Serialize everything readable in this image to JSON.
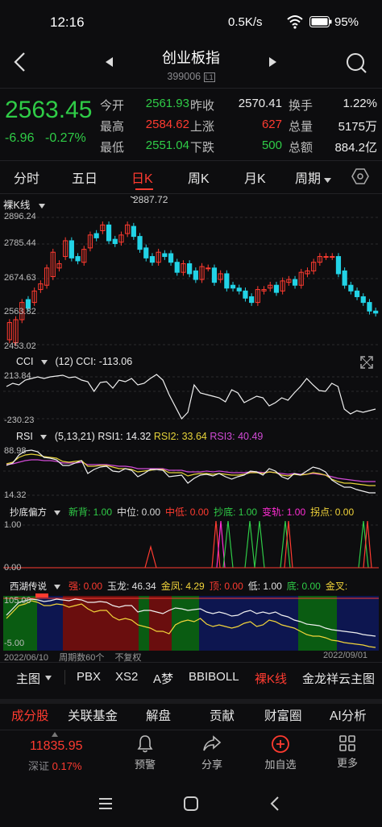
{
  "status": {
    "time": "12:16",
    "net": "0.5K/s",
    "battery": "95%"
  },
  "nav": {
    "title": "创业板指",
    "code": "399006",
    "badge": "L1"
  },
  "quote": {
    "price": "2563.45",
    "change": "-6.96",
    "pct": "-0.27%",
    "fields": [
      {
        "label": "今开",
        "value": "2561.93",
        "color": "#2fcc47"
      },
      {
        "label": "昨收",
        "value": "2570.41",
        "color": "#ececec"
      },
      {
        "label": "换手",
        "value": "1.22%",
        "color": "#ececec"
      },
      {
        "label": "最高",
        "value": "2584.62",
        "color": "#ff3b30"
      },
      {
        "label": "上涨",
        "value": "627",
        "color": "#ff3b30"
      },
      {
        "label": "总量",
        "value": "5175万",
        "color": "#ececec"
      },
      {
        "label": "最低",
        "value": "2551.04",
        "color": "#2fcc47"
      },
      {
        "label": "下跌",
        "value": "500",
        "color": "#2fcc47"
      },
      {
        "label": "总额",
        "value": "884.2亿",
        "color": "#ececec"
      }
    ]
  },
  "tabs": [
    "分时",
    "五日",
    "日K",
    "周K",
    "月K",
    "周期"
  ],
  "kline": {
    "type_label": "裸K线",
    "max_label": "2887.72",
    "y_ticks": [
      "2896.24",
      "2785.44",
      "2674.63",
      "2563.82",
      "2453.02"
    ]
  },
  "cci": {
    "name": "CCI",
    "params": "(12)",
    "value": "CCI: -113.06",
    "ticks": [
      "213.84",
      "-230.23"
    ]
  },
  "rsi": {
    "name": "RSI",
    "params": "(5,13,21)",
    "rsi1": "RSI1: 14.32",
    "rsi2": "RSI2: 33.64",
    "rsi3": "RSI3: 40.49",
    "ticks": [
      "88.98",
      "14.32"
    ]
  },
  "chaodi": {
    "name": "抄底偏方",
    "items": [
      {
        "label": "新背: 1.00",
        "color": "#2fcc47"
      },
      {
        "label": "中位: 0.00",
        "color": "#d9d9d9"
      },
      {
        "label": "中低: 0.00",
        "color": "#ff3b30"
      },
      {
        "label": "抄底: 1.00",
        "color": "#2fcc47"
      },
      {
        "label": "变轨: 1.00",
        "color": "#ff2dd4"
      },
      {
        "label": "拐点: 0.00",
        "color": "#f2d43a"
      }
    ],
    "ticks": [
      "1.00",
      "0.00"
    ]
  },
  "xihu": {
    "name": "西湖传说",
    "items": [
      {
        "label": "强: 0.00",
        "color": "#ff3b30"
      },
      {
        "label": "玉龙: 46.34",
        "color": "#e0e0e0"
      },
      {
        "label": "金凤: 4.29",
        "color": "#f2d43a"
      },
      {
        "label": "顶: 0.00",
        "color": "#ff3b30"
      },
      {
        "label": "低: 1.00",
        "color": "#e0e0e0"
      },
      {
        "label": "底: 0.00",
        "color": "#2fcc47"
      },
      {
        "label": "金叉: ",
        "color": "#f2d43a"
      }
    ],
    "ticks": [
      "105.00",
      "-5.00"
    ],
    "date_start": "2022/06/10",
    "bars_note": "周期数60个",
    "zoom": "不复权",
    "date_end": "2022/09/01"
  },
  "indicator_bar": [
    "主图",
    "PBX",
    "XS2",
    "A梦",
    "BBIBOLL",
    "裸K线",
    "金龙祥云主图"
  ],
  "bottom_tabs": [
    "成分股",
    "关联基金",
    "解盘",
    "贡献",
    "财富圈",
    "AI分析"
  ],
  "dock": {
    "sz_name": "深证",
    "sz_value": "11835.95",
    "sz_pct": "0.17%",
    "buttons": [
      "预警",
      "分享",
      "加自选",
      "更多"
    ]
  },
  "colors": {
    "up": "#ff3b30",
    "down": "#2fcc47",
    "cyan": "#22d3e6",
    "accent": "#ff3b30"
  },
  "chart_data": {
    "type": "candlestick",
    "open": [
      2470,
      2460,
      2540,
      2610,
      2600,
      2645,
      2660,
      2690,
      2720,
      2760,
      2815,
      2760,
      2740,
      2790,
      2840,
      2850,
      2870,
      2820,
      2810,
      2840,
      2865,
      2830,
      2790,
      2760,
      2740,
      2770,
      2770,
      2740,
      2705,
      2735,
      2710,
      2680,
      2720,
      2720,
      2680,
      2700,
      2660,
      2650,
      2640,
      2620,
      2600,
      2640,
      2650,
      2660,
      2640,
      2670,
      2680,
      2660,
      2700,
      2710,
      2740,
      2760,
      2760,
      2760,
      2710,
      2660,
      2640,
      2620,
      2600,
      2570
    ],
    "close": [
      2530,
      2540,
      2600,
      2580,
      2640,
      2665,
      2720,
      2775,
      2735,
      2815,
      2755,
      2745,
      2785,
      2835,
      2825,
      2870,
      2815,
      2805,
      2835,
      2870,
      2830,
      2785,
      2755,
      2740,
      2775,
      2760,
      2740,
      2705,
      2735,
      2700,
      2680,
      2725,
      2720,
      2670,
      2700,
      2650,
      2650,
      2640,
      2615,
      2600,
      2645,
      2645,
      2660,
      2635,
      2675,
      2680,
      2660,
      2705,
      2710,
      2740,
      2760,
      2760,
      2760,
      2700,
      2660,
      2640,
      2620,
      2600,
      2570,
      2563
    ]
  }
}
